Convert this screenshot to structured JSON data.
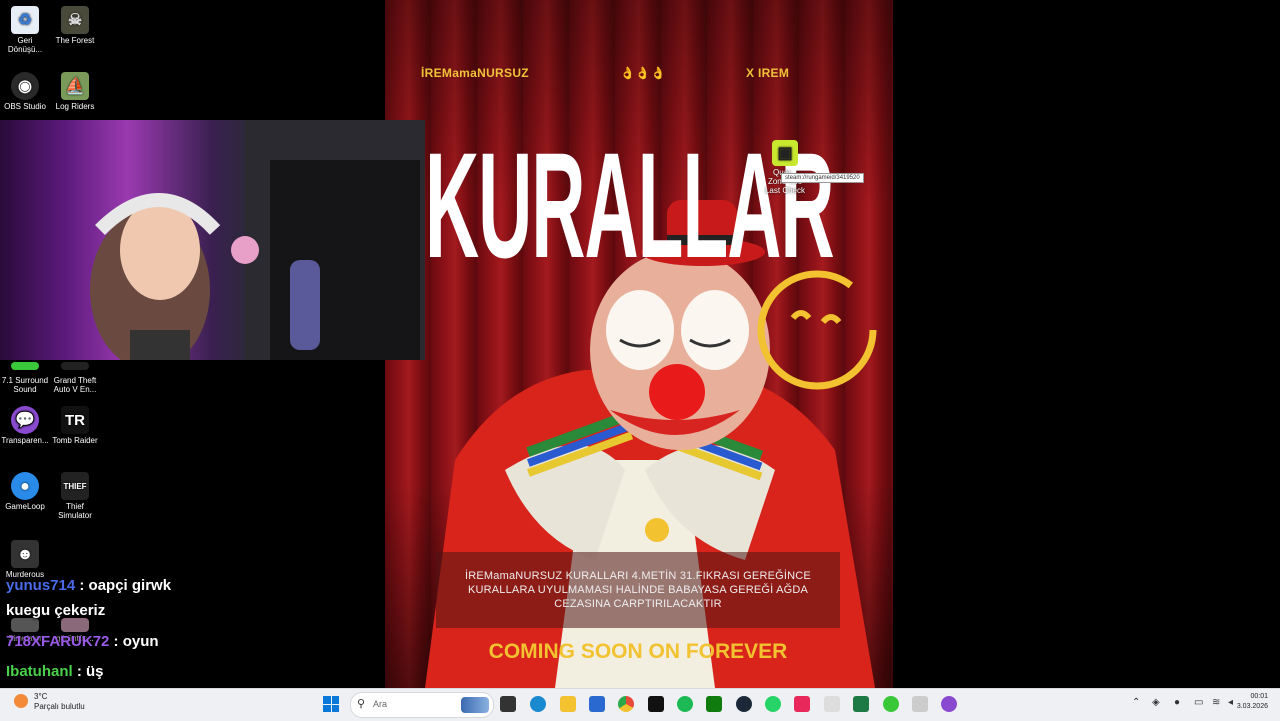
{
  "desktop_icons": [
    {
      "label": "Geri Dönüşü...",
      "icon": "recycle-bin-icon",
      "color": "#e8eef5"
    },
    {
      "label": "The Forest",
      "icon": "forest-skull-icon",
      "color": "#4a4a3a"
    },
    {
      "label": "OBS Studio",
      "icon": "obs-icon",
      "color": "#2a2a2a"
    },
    {
      "label": "Log Riders",
      "icon": "log-riders-icon",
      "color": "#7a9a5a"
    },
    {
      "label": "7.1 Surround Sound",
      "icon": "surround-sound-icon",
      "color": "#3ac83a"
    },
    {
      "label": "Grand Theft Auto V En...",
      "icon": "gta-icon",
      "color": "#222222"
    },
    {
      "label": "Transparen...",
      "icon": "chat-bubble-icon",
      "color": "#8a4ad0"
    },
    {
      "label": "Tomb Raider",
      "icon": "tomb-raider-icon",
      "color": "#111111"
    },
    {
      "label": "GameLoop",
      "icon": "gameloop-icon",
      "color": "#2a8ae8"
    },
    {
      "label": "Thief Simulator",
      "icon": "thief-icon",
      "color": "#222222"
    },
    {
      "label": "Murderous",
      "icon": "murderous-icon",
      "color": "#333333"
    },
    {
      "label": "görüntüs...",
      "icon": "image-icon",
      "color": "#8a6a7a"
    },
    {
      "label": "Simulator",
      "icon": "simulator-icon",
      "color": "#555555"
    }
  ],
  "poster": {
    "top_left": "İREMamaNURSUZ",
    "top_middle": "👌👌👌",
    "top_right": "X IREM",
    "title": "KURALLAR",
    "rules": "İREMamaNURSUZ KURALLARI 4.METİN 31.FIKRASI GEREĞİNCE KURALLARA UYULMAMASI HALİNDE BABAYASA GEREĞİ AĞDA CEZASINA CARPTIRILACAKTIR",
    "coming": "COMING SOON ON FOREVER",
    "accent": "#f2c230"
  },
  "floating_icon": {
    "label_line1": "Quar...",
    "label_line2": "Zone The",
    "label_line3": "Last Check",
    "tooltip": "steam://rungameid/3419520"
  },
  "chat": [
    {
      "user": "yunus714",
      "sep": " : ",
      "text": "oapçi girwk",
      "user_color": "#4a6ae8"
    },
    {
      "user": "",
      "sep": "",
      "text": "kuegu çekeriz",
      "user_color": "#ffffff"
    },
    {
      "user": "718XFARUK72",
      "sep": " : ",
      "text": "oyun",
      "user_color": "#9a5ae8"
    },
    {
      "user": "Ibatuhanl",
      "sep": " : ",
      "text": "üş",
      "user_color": "#4ad04a"
    }
  ],
  "taskbar": {
    "weather_temp": "3°C",
    "weather_desc": "Parçalı bulutlu",
    "search_placeholder": "Ara",
    "time": "00:01",
    "date": "3.03.2026",
    "apps": [
      {
        "icon": "start-windows-icon",
        "color": "#0a78d8"
      },
      {
        "icon": "task-view-icon",
        "color": "#333333"
      },
      {
        "icon": "edge-icon",
        "color": "#1a8ad0"
      },
      {
        "icon": "file-explorer-icon",
        "color": "#f2c230"
      },
      {
        "icon": "store-icon",
        "color": "#2a6ad0"
      },
      {
        "icon": "chrome-icon",
        "color": "#e84a3a"
      },
      {
        "icon": "tiktok-icon",
        "color": "#111111"
      },
      {
        "icon": "spotify-icon",
        "color": "#1db954"
      },
      {
        "icon": "xbox-app-icon",
        "color": "#107c10"
      },
      {
        "icon": "steam-icon",
        "color": "#1b2838"
      },
      {
        "icon": "whatsapp-icon",
        "color": "#25d366"
      },
      {
        "icon": "tiktok-studio-icon",
        "color": "#e8285a"
      },
      {
        "icon": "document-icon",
        "color": "#dddddd"
      },
      {
        "icon": "excel-icon",
        "color": "#1d7a44"
      },
      {
        "icon": "vpn-icon",
        "color": "#3ac83a"
      },
      {
        "icon": "notepad-icon",
        "color": "#cccccc"
      },
      {
        "icon": "twitch-icon",
        "color": "#8a4ad0"
      }
    ]
  }
}
